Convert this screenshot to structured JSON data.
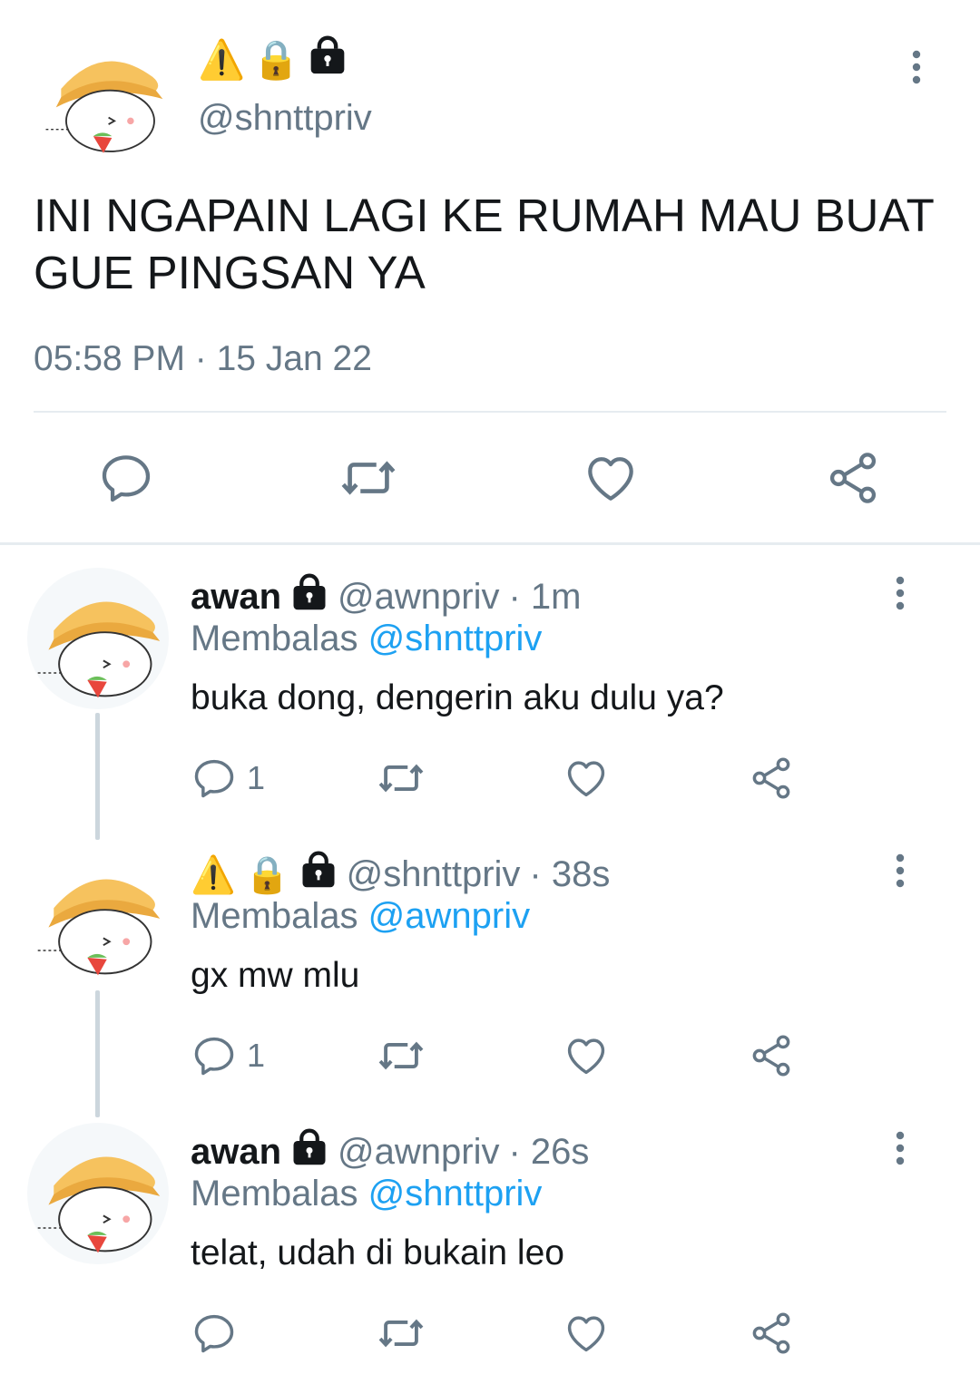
{
  "main_tweet": {
    "badges": [
      "⚠️",
      "🔒",
      "🔐"
    ],
    "handle": "@shnttpriv",
    "text": "INI NGAPAIN LAGI KE RUMAH MAU BUAT GUE PINGSAN YA",
    "time": "05:58 PM · 15 Jan 22"
  },
  "replies": [
    {
      "name": "awan",
      "handle": "@awnpriv",
      "age": "· 1m",
      "replying_prefix": "Membalas",
      "replying_to": "@shnttpriv",
      "text": "buka dong, dengerin aku dulu ya?",
      "reply_count": "1"
    },
    {
      "badges": [
        "⚠️",
        "🔒"
      ],
      "handle": "@shnttpriv",
      "age": "· 38s",
      "replying_prefix": "Membalas",
      "replying_to": "@awnpriv",
      "text": "gx mw mlu",
      "reply_count": "1"
    },
    {
      "name": "awan",
      "handle": "@awnpriv",
      "age": "· 26s",
      "replying_prefix": "Membalas",
      "replying_to": "@shnttpriv",
      "text": "telat, udah di bukain leo",
      "reply_count": ""
    }
  ],
  "icons": {
    "reply": "reply-bubble-icon",
    "retweet": "retweet-icon",
    "like": "heart-icon",
    "share": "share-icon",
    "more": "more-vertical-icon",
    "lock": "black-lock-icon"
  },
  "colors": {
    "accent": "#1da1f2",
    "muted": "#657786",
    "text": "#14171a",
    "divider": "#e6ecf0"
  }
}
